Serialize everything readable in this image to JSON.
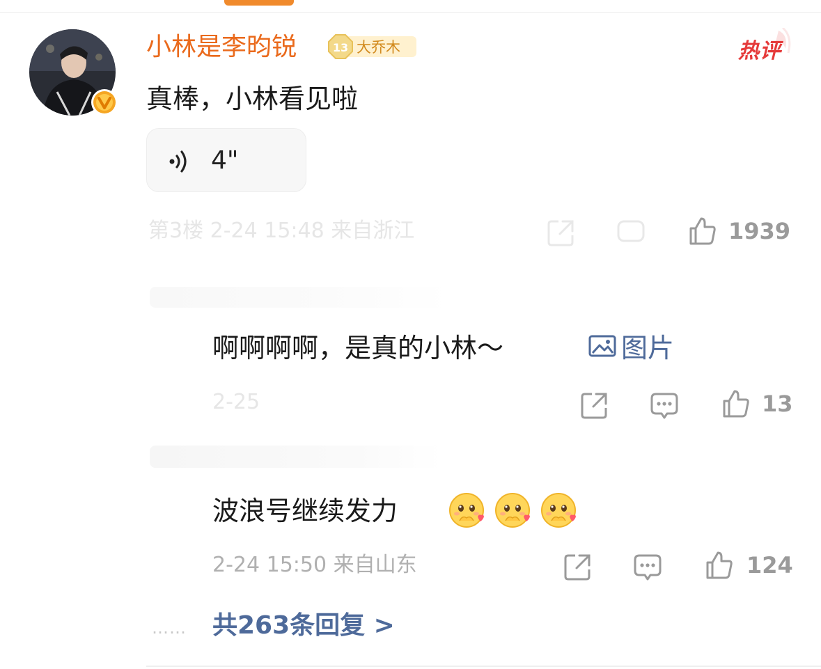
{
  "comment": {
    "username": "小林是李昀锐",
    "level_badge": {
      "number": "13",
      "title": "大乔木"
    },
    "hot_label": "热评",
    "text": "真棒，小林看见啦",
    "voice_duration": "4\"",
    "meta": "第3楼 2-24 15:48 来自浙江",
    "like_count": "1939"
  },
  "replies": [
    {
      "text": "啊啊啊啊，是真的小林～",
      "image_link": "图片",
      "meta": "2-25",
      "like_count": "13"
    },
    {
      "text": "波浪号继续发力",
      "meta": "2-24 15:50 来自山东",
      "like_count": "124"
    }
  ],
  "more_replies": "共263条回复 >",
  "icons": [
    "v-badge-icon",
    "voice-icon",
    "share-icon",
    "comment-icon",
    "like-icon",
    "image-icon",
    "hug-emoji-icon"
  ],
  "colors": {
    "username": "#ea6a1c",
    "link": "#4e6a9a",
    "hot": "#e53a3a",
    "meta": "#b0b0b0"
  }
}
